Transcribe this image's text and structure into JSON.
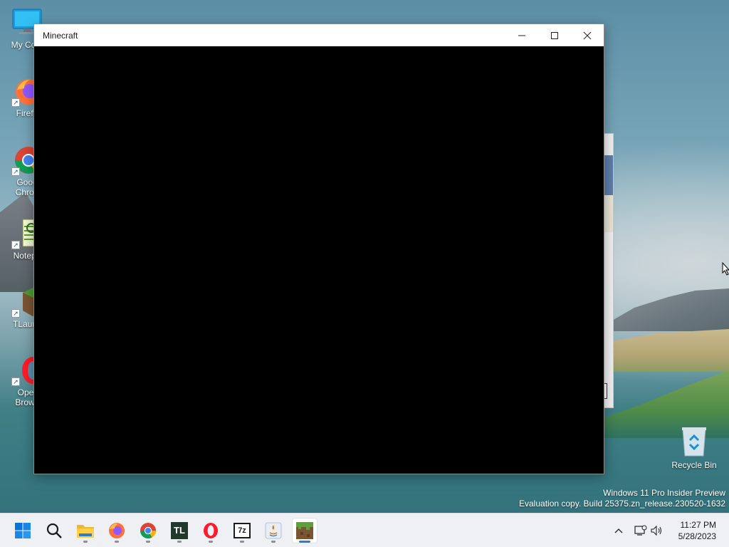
{
  "desktop": {
    "icons": [
      {
        "label": "My Com",
        "icon": "computer-icon"
      },
      {
        "label": "Firefo",
        "icon": "firefox-icon"
      },
      {
        "label": "Goog\nChron",
        "icon": "chrome-icon"
      },
      {
        "label": "Notepa",
        "icon": "notepad-icon"
      },
      {
        "label": "TLaunc",
        "icon": "tlauncher-icon"
      },
      {
        "label": "Oper\nBrows",
        "icon": "opera-icon"
      }
    ],
    "recycle_bin": "Recycle Bin"
  },
  "window": {
    "title": "Minecraft",
    "minimize_glyph": "—",
    "maximize_glyph": "☐",
    "close_glyph": "✕"
  },
  "watermark": {
    "line1": "Windows 11 Pro Insider Preview",
    "line2": "Evaluation copy. Build 25375.zn_release.230520-1632"
  },
  "taskbar": {
    "apps": [
      {
        "name": "start",
        "icon": "windows-start-icon",
        "running": false
      },
      {
        "name": "search",
        "icon": "search-icon",
        "running": false
      },
      {
        "name": "file-explorer",
        "icon": "folder-icon",
        "running": true
      },
      {
        "name": "firefox",
        "icon": "firefox-icon",
        "running": true
      },
      {
        "name": "chrome",
        "icon": "chrome-icon",
        "running": true
      },
      {
        "name": "tlauncher",
        "icon": "tlauncher-icon",
        "running": true
      },
      {
        "name": "opera",
        "icon": "opera-icon",
        "running": true
      },
      {
        "name": "7zip",
        "icon": "7zip-icon",
        "running": true
      },
      {
        "name": "java",
        "icon": "java-icon",
        "running": true
      },
      {
        "name": "minecraft",
        "icon": "minecraft-icon",
        "running": true,
        "active": true
      }
    ],
    "tl_text": "TL",
    "sevenzip_text": "7z",
    "clock_time": "11:27 PM",
    "clock_date": "5/28/2023"
  }
}
